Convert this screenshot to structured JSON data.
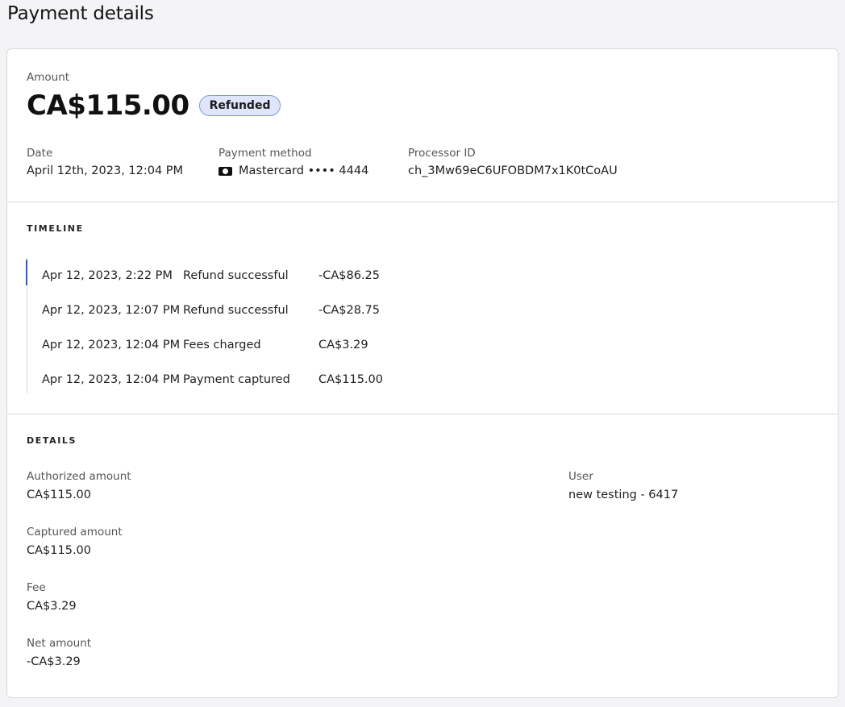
{
  "page": {
    "title": "Payment details"
  },
  "summary": {
    "amount_label": "Amount",
    "amount": "CA$115.00",
    "status": "Refunded",
    "date_label": "Date",
    "date": "April 12th, 2023, 12:04 PM",
    "payment_method_label": "Payment method",
    "payment_method": "Mastercard •••• 4444",
    "payment_method_icon": "credit-card-icon",
    "processor_id_label": "Processor ID",
    "processor_id": "ch_3Mw69eC6UFOBDM7x1K0tCoAU"
  },
  "timeline": {
    "title": "TIMELINE",
    "events": [
      {
        "date": "Apr 12, 2023, 2:22 PM",
        "event": "Refund successful",
        "amount": "-CA$86.25"
      },
      {
        "date": "Apr 12, 2023, 12:07 PM",
        "event": "Refund successful",
        "amount": "-CA$28.75"
      },
      {
        "date": "Apr 12, 2023, 12:04 PM",
        "event": "Fees charged",
        "amount": "CA$3.29"
      },
      {
        "date": "Apr 12, 2023, 12:04 PM",
        "event": "Payment captured",
        "amount": "CA$115.00"
      }
    ]
  },
  "details": {
    "title": "DETAILS",
    "left": [
      {
        "label": "Authorized amount",
        "value": "CA$115.00"
      },
      {
        "label": "Captured amount",
        "value": "CA$115.00"
      },
      {
        "label": "Fee",
        "value": "CA$3.29"
      },
      {
        "label": "Net amount",
        "value": "-CA$3.29"
      }
    ],
    "right": [
      {
        "label": "User",
        "value": "new testing - 6417"
      }
    ]
  },
  "colors": {
    "accent": "#3057c8",
    "badge_bg": "#dfe6fb",
    "badge_border": "#7d97e6"
  }
}
